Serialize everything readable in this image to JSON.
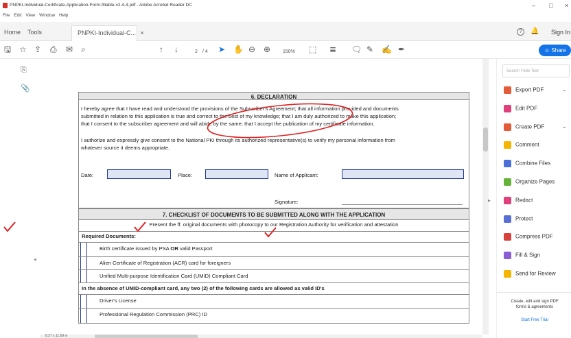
{
  "window": {
    "title": "PNPKI-Individual-Certificate-Application-Form-fillable-v2.4-4.pdf - Adobe Acrobat Reader DC",
    "controls": [
      "–",
      "□",
      "×"
    ]
  },
  "menubar": [
    "File",
    "Edit",
    "View",
    "Window",
    "Help"
  ],
  "tabs": {
    "home": "Home",
    "tools": "Tools",
    "doc": "PNPKI-Individual-C...",
    "doc_close": "×",
    "sign_in": "Sign In"
  },
  "toolbar": {
    "page_current": "2",
    "page_total": "/ 4",
    "zoom": "150%",
    "share_label": "Share"
  },
  "document": {
    "sec6_title": "6. DECLARATION",
    "decl_p1_l1": "I hereby agree that I have read and understood the provisions of the Subscriber's Agreement; that all information provided and documents",
    "decl_p1_l2": "submitted in relation to this application is true and correct to the best of my knowledge; that I am duly authorized to make this application;",
    "decl_p1_l3": "that I consent to the subscriber agreement and will abide by the same; that I accept the publication of my certificate information.",
    "decl_p2_l1": "I authorize and expressly give consent to the National PKI through its authorized representative(s) to verify my personal information from",
    "decl_p2_l2": "whatever source it deems appropriate.",
    "date_label": "Date:",
    "place_label": "Place:",
    "name_label": "Name of Applicant:",
    "signature_label": "Signature:",
    "sec7_title": "7. CHECKLIST OF DOCUMENTS TO BE SUBMITTED ALONG WITH THE APPLICATION",
    "sec7_sub": "Present the ff. original documents with photocopy to our Registration Authority for verification and attestation",
    "required_label": "Required Documents:",
    "req_items": [
      "Birth certificate issued by PSA",
      "Alien Certificate of Registration (ACR) card for foreigners",
      "Unified Multi-purpose Identification Card (UMID) Compliant Card"
    ],
    "or_word": "OR",
    "passport_text": "valid Passport",
    "absence_text": "In the absence of UMID-compliant card, any two (2) of the following cards are allowed as valid ID's",
    "alt_items": [
      "Driver's License",
      "Professional Regulation Commission (PRC) ID"
    ],
    "page_size": "8.27 x 11.69 in"
  },
  "right_pane": {
    "search_placeholder": "Search 'Hide Text'",
    "tools": [
      {
        "label": "Export PDF",
        "color": "#e45b3a",
        "chevron": true
      },
      {
        "label": "Edit PDF",
        "color": "#e0417a",
        "chevron": false
      },
      {
        "label": "Create PDF",
        "color": "#e45b3a",
        "chevron": true
      },
      {
        "label": "Comment",
        "color": "#f4b400",
        "chevron": false
      },
      {
        "label": "Combine Files",
        "color": "#4a6fd6",
        "chevron": false
      },
      {
        "label": "Organize Pages",
        "color": "#66b33a",
        "chevron": false
      },
      {
        "label": "Redact",
        "color": "#e0417a",
        "chevron": false
      },
      {
        "label": "Protect",
        "color": "#5a6fd6",
        "chevron": false
      },
      {
        "label": "Compress PDF",
        "color": "#d6413a",
        "chevron": false
      },
      {
        "label": "Fill & Sign",
        "color": "#8a5cd6",
        "chevron": false
      },
      {
        "label": "Send for Review",
        "color": "#f4b400",
        "chevron": false
      }
    ],
    "promo_l1": "Create, edit and sign PDF",
    "promo_l2": "forms & agreements",
    "trial": "Start Free Trial"
  },
  "colors": {
    "accent": "#1473e6",
    "annotation_red": "#e02020",
    "field_border": "#1f3a93"
  }
}
